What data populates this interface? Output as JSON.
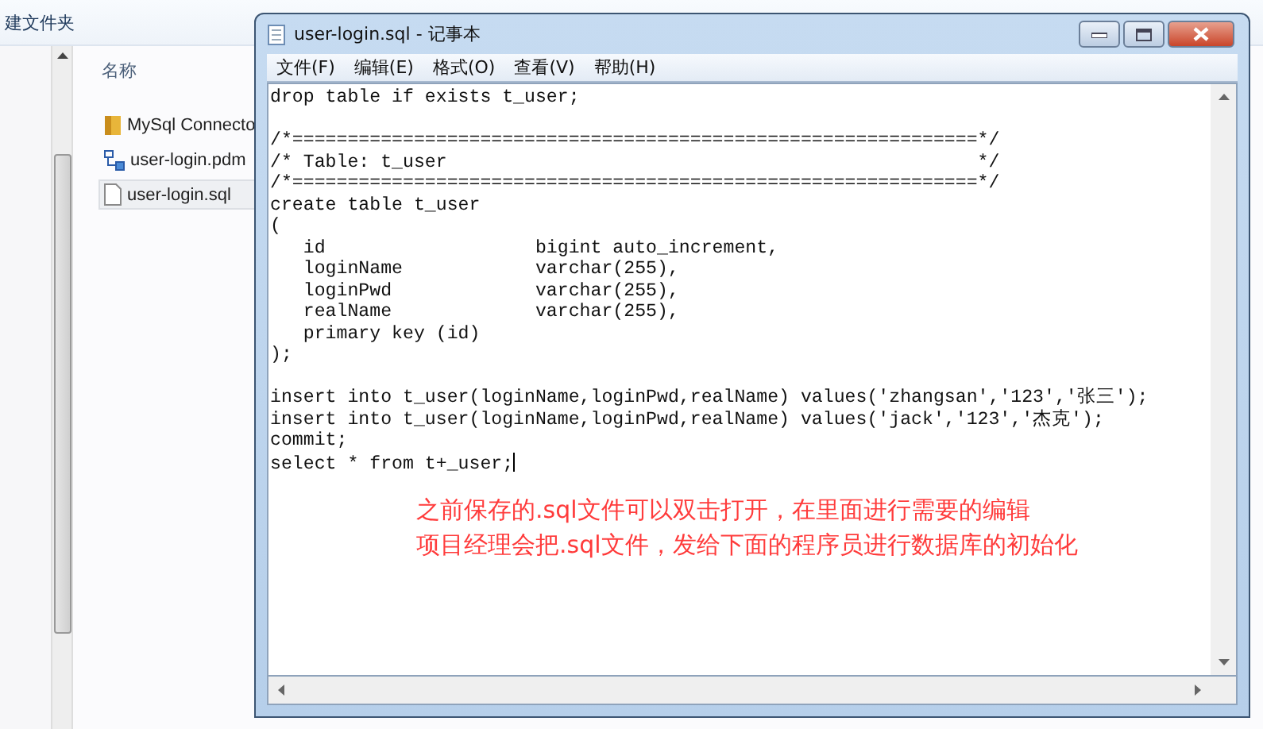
{
  "explorer": {
    "toolbar_label": "建文件夹",
    "column_header": "名称",
    "files": [
      {
        "name": "MySql Connecto",
        "kind": "folder",
        "selected": false
      },
      {
        "name": "user-login.pdm",
        "kind": "model",
        "selected": false
      },
      {
        "name": "user-login.sql",
        "kind": "file",
        "selected": true
      }
    ]
  },
  "window": {
    "title": "user-login.sql - 记事本",
    "menu": [
      "文件(F)",
      "编辑(E)",
      "格式(O)",
      "查看(V)",
      "帮助(H)"
    ],
    "paragraphs": [
      [
        "drop table if exists t_user;"
      ],
      [
        "/*==============================================================*/",
        "/* Table: t_user                                                */",
        "/*==============================================================*/",
        "create table t_user",
        "(",
        "   id                   bigint auto_increment,",
        "   loginName            varchar(255),",
        "   loginPwd             varchar(255),",
        "   realName             varchar(255),",
        "   primary key (id)",
        ");"
      ],
      [
        "insert into t_user(loginName,loginPwd,realName) values('zhangsan','123','张三');",
        "insert into t_user(loginName,loginPwd,realName) values('jack','123','杰克');",
        "commit;",
        "select * from t+_user;"
      ]
    ]
  },
  "annotation": [
    "之前保存的.sql文件可以双击打开，在里面进行需要的编辑",
    "项目经理会把.sql文件，发给下面的程序员进行数据库的初始化"
  ]
}
